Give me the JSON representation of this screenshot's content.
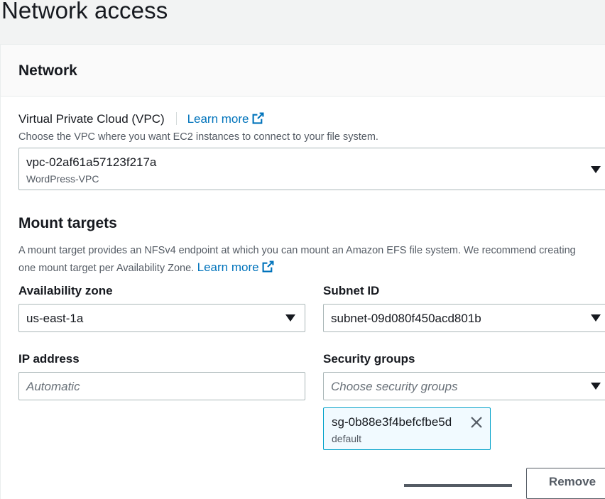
{
  "page": {
    "title": "Network access"
  },
  "network": {
    "title": "Network",
    "vpc": {
      "label": "Virtual Private Cloud (VPC)",
      "learn_more": "Learn more",
      "description": "Choose the VPC where you want EC2 instances to connect to your file system.",
      "value": "vpc-02af61a57123f217a",
      "sub": "WordPress-VPC"
    },
    "mount_targets": {
      "title": "Mount targets",
      "description_line1": "A mount target provides an NFSv4 endpoint at which you can mount an Amazon EFS file system. We recommend creating",
      "description_line2": "one mount target per Availability Zone.",
      "learn_more": "Learn more",
      "availability_zone": {
        "label": "Availability zone",
        "value": "us-east-1a"
      },
      "subnet": {
        "label": "Subnet ID",
        "value": "subnet-09d080f450acd801b"
      },
      "ip_address": {
        "label": "IP address",
        "placeholder": "Automatic"
      },
      "security_groups": {
        "label": "Security groups",
        "placeholder": "Choose security groups",
        "token_value": "sg-0b88e3f4befcfbe5d",
        "token_sub": "default"
      },
      "remove_label": "Remove"
    }
  },
  "icons": {
    "external_link": "external-link-icon",
    "caret": "caret-down-icon",
    "dismiss": "close-icon"
  },
  "colors": {
    "link": "#0073bb",
    "token_bg": "#f1faff",
    "token_border": "#00a1c9"
  }
}
